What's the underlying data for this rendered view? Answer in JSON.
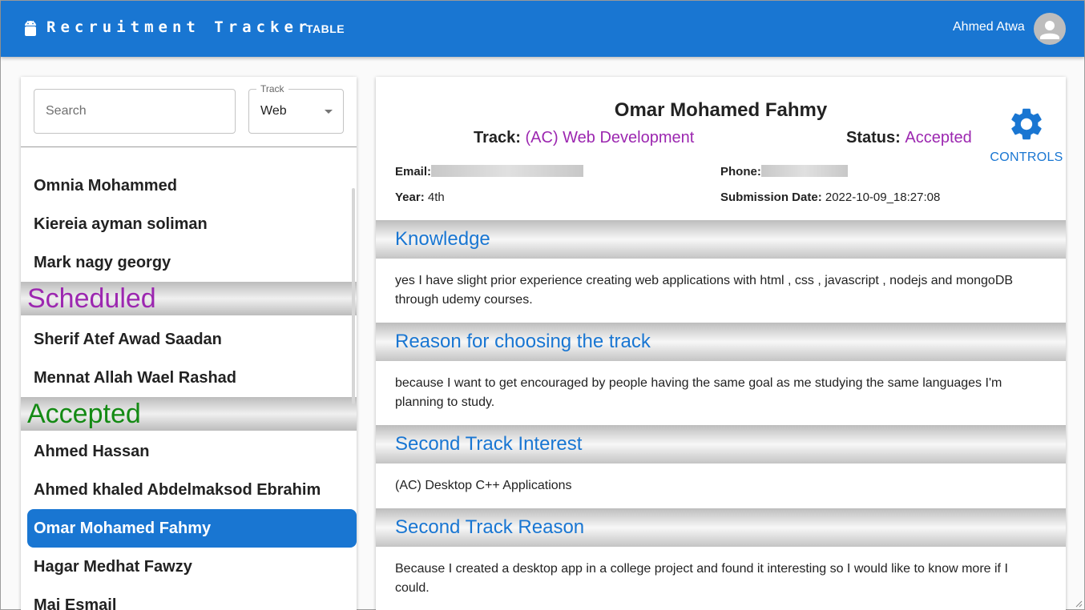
{
  "header": {
    "title": "Recruitment Tracker",
    "nav_table": "TABLE",
    "user_name": "Ahmed Atwa",
    "bg_color": "#1976d2"
  },
  "filters": {
    "search_placeholder": "Search",
    "track_label": "Track",
    "track_value": "Web"
  },
  "candidates": {
    "top_items": [
      "Omnia Mohammed",
      "Kiereia ayman soliman",
      "Mark nagy georgy"
    ],
    "scheduled_label": "Scheduled",
    "scheduled_color": "#9c27b0",
    "scheduled_items": [
      "Sherif Atef Awad Saadan",
      "Mennat Allah Wael Rashad"
    ],
    "accepted_label": "Accepted",
    "accepted_color": "#148a14",
    "accepted_items": [
      "Ahmed Hassan",
      "Ahmed khaled Abdelmaksod Ebrahim",
      "Omar Mohamed Fahmy",
      "Hagar Medhat Fawzy",
      "Mai Esmail"
    ],
    "selected": "Omar Mohamed Fahmy"
  },
  "detail": {
    "name": "Omar Mohamed Fahmy",
    "track_label": "Track:",
    "track_value": "(AC) Web Development",
    "status_label": "Status:",
    "status_value": "Accepted",
    "controls_label": "CONTROLS",
    "email_label": "Email:",
    "phone_label": "Phone:",
    "year_label": "Year:",
    "year_value": "4th",
    "submission_label": "Submission Date:",
    "submission_value": "2022-10-09_18:27:08",
    "sections": [
      {
        "title": "Knowledge",
        "body": "yes I have slight prior experience creating web applications with html , css , javascript , nodejs and mongoDB through udemy courses."
      },
      {
        "title": "Reason for choosing the track",
        "body": "because I want to get encouraged by people having the same goal as me studying the same languages I'm planning to study."
      },
      {
        "title": "Second Track Interest",
        "body": "(AC) Desktop C++ Applications"
      },
      {
        "title": "Second Track Reason",
        "body": "Because I created a desktop app in a college project and found it interesting so I would like to know more if I could."
      }
    ]
  }
}
